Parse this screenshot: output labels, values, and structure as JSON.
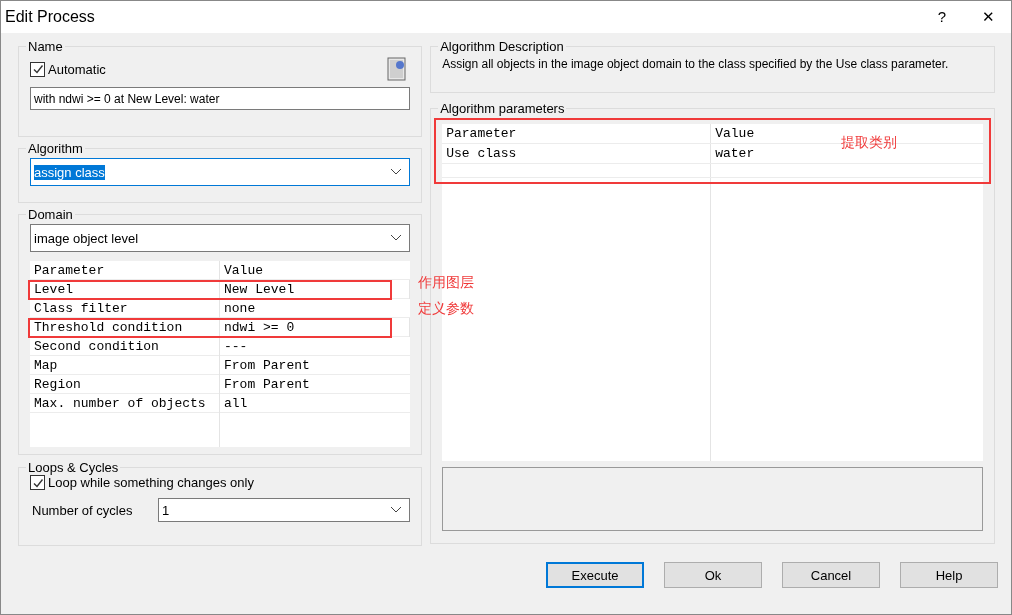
{
  "window": {
    "title": "Edit Process",
    "help_glyph": "?",
    "close_glyph": "✕"
  },
  "name_group": {
    "title": "Name",
    "automatic": {
      "label": "Automatic",
      "checked": true
    },
    "value": "with ndwi >= 0  at  New Level: water"
  },
  "algorithm_group": {
    "title": "Algorithm",
    "value": "assign class",
    "text_selected": true
  },
  "domain_group": {
    "title": "Domain",
    "value": "image object level",
    "table": {
      "columns": [
        "Parameter",
        "Value"
      ],
      "rows": [
        {
          "parameter": "Level",
          "value": "New Level",
          "highlighted": true,
          "annotation": "作用图层"
        },
        {
          "parameter": "Class filter",
          "value": "none",
          "highlighted": false
        },
        {
          "parameter": "Threshold condition",
          "value": "ndwi >= 0",
          "highlighted": true,
          "annotation": "定义参数"
        },
        {
          "parameter": "Second condition",
          "value": "---",
          "highlighted": false
        },
        {
          "parameter": "Map",
          "value": "From Parent",
          "highlighted": false
        },
        {
          "parameter": "Region",
          "value": "From Parent",
          "highlighted": false
        },
        {
          "parameter": "Max. number of objects",
          "value": "all",
          "highlighted": false
        }
      ]
    }
  },
  "loops_group": {
    "title": "Loops & Cycles",
    "loop_option": {
      "label": "Loop while something changes only",
      "checked": true
    },
    "cycles_label": "Number of cycles",
    "cycles_value": "1"
  },
  "description_group": {
    "title": "Algorithm Description",
    "text": "Assign all objects in the image object domain to the class specified by the Use class parameter."
  },
  "parameters_group": {
    "title": "Algorithm parameters",
    "highlighted": true,
    "annotation": "提取类别",
    "table": {
      "columns": [
        "Parameter",
        "Value"
      ],
      "rows": [
        {
          "parameter": "Use class",
          "value": "water"
        }
      ]
    }
  },
  "buttons": [
    {
      "label": "Execute",
      "default": true
    },
    {
      "label": "Ok",
      "default": false
    },
    {
      "label": "Cancel",
      "default": false
    },
    {
      "label": "Help",
      "default": false
    }
  ]
}
